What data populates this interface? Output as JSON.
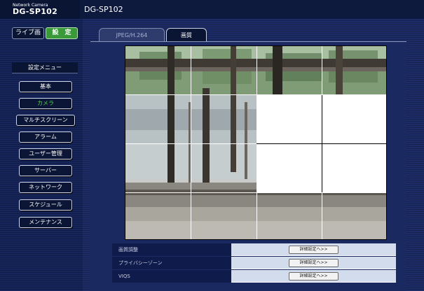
{
  "header": {
    "brand_small": "Network Camera",
    "brand_model": "DG-SP102",
    "title": "DG-SP102"
  },
  "mode_tabs": {
    "live_label": "ライブ画",
    "setup_label": "設　定",
    "active": "setup"
  },
  "menu": {
    "title": "設定メニュー",
    "items": [
      {
        "label": "基本",
        "active": false
      },
      {
        "label": "カメラ",
        "active": true
      },
      {
        "label": "マルチスクリーン",
        "active": false
      },
      {
        "label": "アラーム",
        "active": false
      },
      {
        "label": "ユーザー管理",
        "active": false
      },
      {
        "label": "サーバー",
        "active": false
      },
      {
        "label": "ネットワーク",
        "active": false
      },
      {
        "label": "スケジュール",
        "active": false
      },
      {
        "label": "メンテナンス",
        "active": false
      }
    ]
  },
  "tabs": {
    "items": [
      {
        "label": "JPEG/H.264",
        "active": false
      },
      {
        "label": "画質",
        "active": true
      }
    ]
  },
  "camera": {
    "grid_rows": 4,
    "grid_cols": 4,
    "masked_cells": [
      [
        1,
        2
      ],
      [
        1,
        3
      ],
      [
        2,
        2
      ],
      [
        2,
        3
      ]
    ]
  },
  "settings": {
    "rows": [
      {
        "label": "画質調整",
        "button": "詳細設定へ>>"
      },
      {
        "label": "プライバシーゾーン",
        "button": "詳細設定へ>>"
      },
      {
        "label": "VIQS",
        "button": "詳細設定へ>>"
      }
    ]
  },
  "colors": {
    "header_bg": "#0d1a3d",
    "setup_active": "#3a9a3a",
    "menu_active_text": "#49d24a",
    "row_value_bg": "#d3dced"
  }
}
